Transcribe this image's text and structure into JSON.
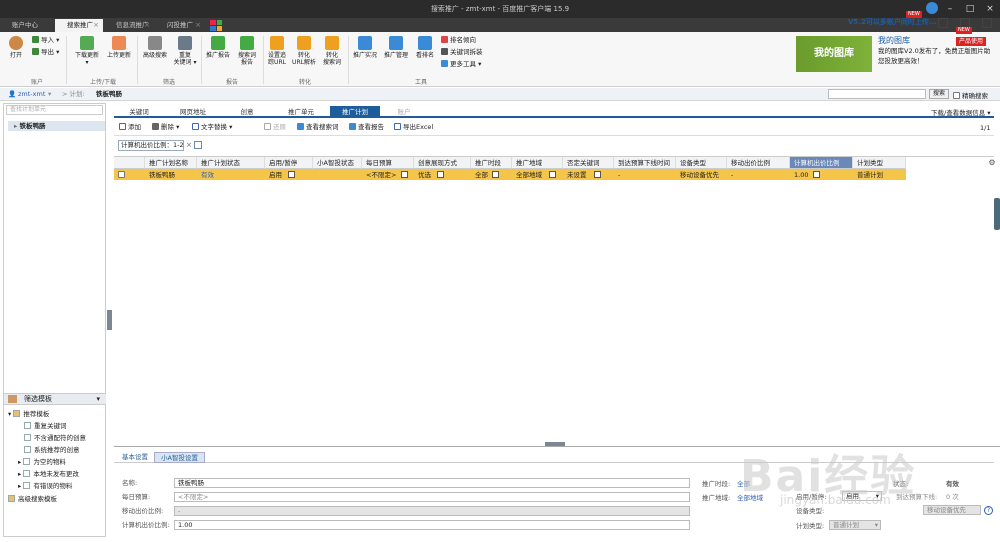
{
  "window": {
    "title": "搜索推广 - zmt-xmt - 百度推广客户端 15.9"
  },
  "app_tabs": [
    {
      "label": "账户中心"
    },
    {
      "label": "搜索推广"
    },
    {
      "label": "信息流推广"
    },
    {
      "label": "闪投推广"
    }
  ],
  "topright": {
    "notice": "V5.2可以多账户同时上传...",
    "new_badge": "NEW",
    "product_badge": "产品使用"
  },
  "ribbon": {
    "buttons": {
      "open": "打开",
      "import": "导入",
      "export": "导出",
      "download_update": "下载更新",
      "upload_update": "上传更新",
      "advanced_search": "高级搜索",
      "re_search_1": "重复",
      "re_search_2": "关键词",
      "promo_report": "推广报告",
      "search_report_1": "搜索词",
      "search_report_2": "报告",
      "set_track_1": "设置追",
      "set_track_2": "踪URL",
      "url_parse_1": "转化",
      "url_parse_2": "URL解析",
      "conv_search_1": "转化",
      "conv_search_2": "搜索词",
      "live_view": "推广实况",
      "manage": "推广管理",
      "ranking": "看排名",
      "rank_tend": "排名倾向",
      "kw_planner": "关键词拆装",
      "more_tools": "更多工具"
    },
    "groups": {
      "account": "账户",
      "updown": "上传/下载",
      "filter": "筛选",
      "report": "报告",
      "convert": "转化",
      "tools": "工具"
    }
  },
  "promo": {
    "title": "我的图库",
    "image_text": "我的图库",
    "text": "我的图库V2.0发布了，免费正版图片助您投放更高效！"
  },
  "breadcrumb": {
    "account": "zmt-xmt",
    "sep": "> 计划:",
    "plan": "铁板鸭肠"
  },
  "search": {
    "button": "搜索",
    "exact": "精确搜索"
  },
  "left": {
    "search_placeholder": "查找计划单元",
    "plan_node": "铁板鸭肠",
    "filter_title": "筛选模板",
    "tree": {
      "recommended": "推荐模板",
      "items": [
        "重复关键词",
        "不含通配符的创意",
        "系统推荐的创意",
        "为空的物料",
        "本地未发布更改",
        "有错误的物料"
      ],
      "advanced": "高级搜索模板"
    }
  },
  "module_tabs": [
    "关键词",
    "网页地址",
    "创意",
    "推广单元",
    "推广计划",
    "账户"
  ],
  "download_view": "下载/查看数据信息",
  "toolbar": {
    "add": "添加",
    "delete": "删除",
    "text_replace": "文字替换",
    "restore": "还原",
    "view_search": "查看搜索词",
    "view_report": "查看报告",
    "export_excel": "导出Excel"
  },
  "pager": "1/1",
  "filter_chip": "计算机出价比例：1-2",
  "grid": {
    "headers": [
      "推广计划名称",
      "推广计划状态",
      "启用/暂停",
      "小A智投状态",
      "每日预算",
      "创意展现方式",
      "推广时段",
      "推广地域",
      "否定关键词",
      "到达预算下线时间",
      "设备类型",
      "移动出价比例",
      "计算机出价比例",
      "计划类型"
    ],
    "row": [
      "铁板鸭肠",
      "有效",
      "启用",
      "",
      "<不限定>",
      "优选",
      "全部",
      "全部地域",
      "未设置",
      "-",
      "移动设备优先",
      "-",
      "1.00",
      "普通计划"
    ]
  },
  "bottom": {
    "tabs": [
      "基本设置",
      "小A智投设置"
    ],
    "fields": {
      "name_label": "名称:",
      "name_value": "铁板鸭肠",
      "budget_label": "每日预算:",
      "budget_value": "<不限定>",
      "mobile_label": "移动出价比例:",
      "mobile_value": "-",
      "pc_label": "计算机出价比例:",
      "pc_value": "1.00",
      "time_label": "推广时段:",
      "time_value": "全部",
      "region_label": "推广地域:",
      "region_value": "全部地域",
      "status_label": "状态:",
      "status_value": "有效",
      "enable_label": "启用/暂停:",
      "enable_value": "启用",
      "arrive_label": "到达预算下线:",
      "arrive_value": "0 次",
      "device_label": "设备类型:",
      "device_value": "移动设备优先",
      "type_label": "计划类型:",
      "type_value": "普通计划"
    }
  },
  "watermark": {
    "main": "Bai经验",
    "sub": "jingyan.baidu.com"
  },
  "colors": {
    "accent": "#1d5d9b",
    "selected_row": "#f5c54a",
    "title_bar": "#2b2b2b"
  }
}
